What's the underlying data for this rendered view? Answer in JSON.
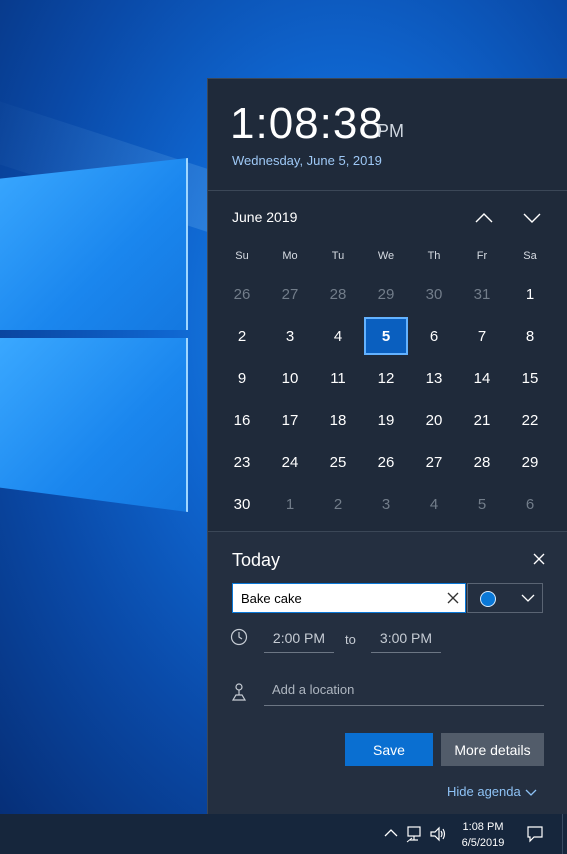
{
  "clock": {
    "time": "1:08:38",
    "ampm": "PM",
    "date": "Wednesday, June 5, 2019"
  },
  "calendar": {
    "month_label": "June 2019",
    "weekdays": [
      "Su",
      "Mo",
      "Tu",
      "We",
      "Th",
      "Fr",
      "Sa"
    ],
    "weeks": [
      [
        "26",
        "27",
        "28",
        "29",
        "30",
        "31",
        "1"
      ],
      [
        "2",
        "3",
        "4",
        "5",
        "6",
        "7",
        "8"
      ],
      [
        "9",
        "10",
        "11",
        "12",
        "13",
        "14",
        "15"
      ],
      [
        "16",
        "17",
        "18",
        "19",
        "20",
        "21",
        "22"
      ],
      [
        "23",
        "24",
        "25",
        "26",
        "27",
        "28",
        "29"
      ],
      [
        "30",
        "1",
        "2",
        "3",
        "4",
        "5",
        "6"
      ]
    ],
    "selected_day": "5"
  },
  "agenda": {
    "title": "Today",
    "event_name": "Bake cake",
    "event_color": "#0a78d7",
    "start_time": "2:00 PM",
    "to_label": "to",
    "end_time": "3:00 PM",
    "location_placeholder": "Add a location",
    "save_label": "Save",
    "more_details_label": "More details",
    "hide_agenda_label": "Hide agenda"
  },
  "taskbar": {
    "time": "1:08 PM",
    "date": "6/5/2019"
  }
}
